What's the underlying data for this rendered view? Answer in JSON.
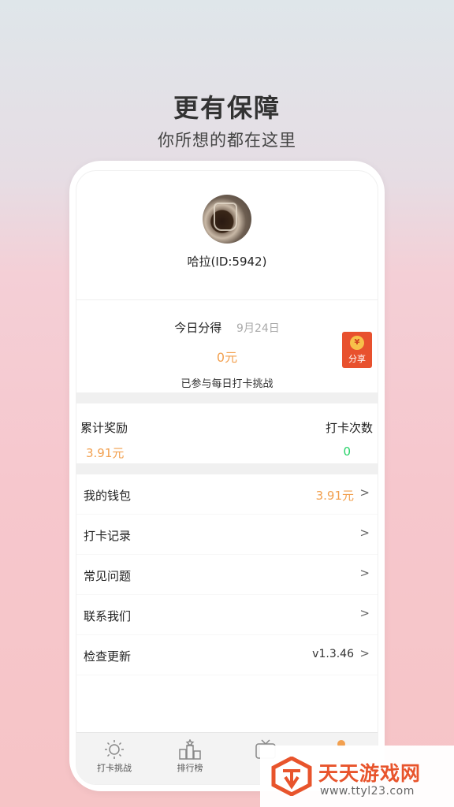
{
  "promo": {
    "headline": "更有保障",
    "subline": "你所想的都在这里"
  },
  "profile": {
    "username": "哈拉(ID:5942)"
  },
  "today": {
    "label": "今日分得",
    "date": "9月24日",
    "amount": "0元",
    "note": "已参与每日打卡挑战",
    "share_label": "分享",
    "share_coin": "¥"
  },
  "stats": {
    "total_reward_label": "累计奖励",
    "total_reward_value": "3.91元",
    "checkin_count_label": "打卡次数",
    "checkin_count_value": "0"
  },
  "menu": [
    {
      "label": "我的钱包",
      "value": "3.91元"
    },
    {
      "label": "打卡记录",
      "value": ""
    },
    {
      "label": "常见问题",
      "value": ""
    },
    {
      "label": "联系我们",
      "value": ""
    },
    {
      "label": "检查更新",
      "value": "v1.3.46"
    }
  ],
  "chevron": ">",
  "tabbar": [
    {
      "label": "打卡挑战",
      "icon": "sun-icon"
    },
    {
      "label": "排行榜",
      "icon": "podium-icon"
    },
    {
      "label": "",
      "icon": "tv-icon"
    },
    {
      "label": "",
      "icon": "profile-dot-icon"
    }
  ],
  "watermark": {
    "title": "天天游戏网",
    "url": "www.ttyl23.com"
  },
  "colors": {
    "accent": "#f2a04f",
    "count_green": "#2bd36b",
    "share_red": "#e8512e"
  }
}
